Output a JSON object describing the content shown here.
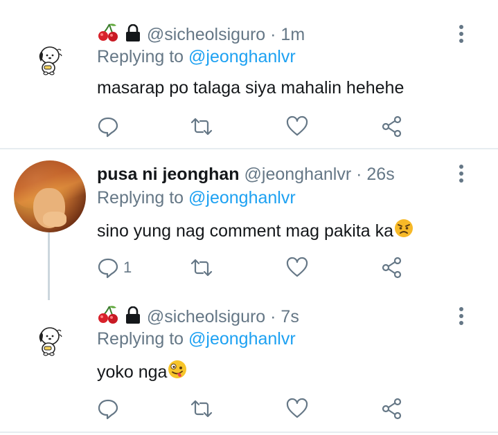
{
  "tweets": [
    {
      "name": "",
      "handle": "@sicheolsiguro",
      "dot": " · ",
      "time": "1m",
      "replying_prefix": "Replying to ",
      "replying_to": "@jeonghanlvr",
      "text": "masarap po talaga siya mahalin hehehe",
      "reply_count": "",
      "avatar_icon": "pochacco-avatar",
      "badges": [
        "cherries-emoji",
        "lock-icon"
      ]
    },
    {
      "name": "pusa ni jeonghan",
      "handle": "@jeonghanlvr",
      "dot": " · ",
      "time": "26s",
      "replying_prefix": "Replying to ",
      "replying_to": "@jeonghanlvr",
      "text": "sino yung nag comment mag pakita ka",
      "text_emoji": "angry-face-emoji",
      "reply_count": "1",
      "avatar_icon": "profile-photo"
    },
    {
      "name": "",
      "handle": "@sicheolsiguro",
      "dot": " · ",
      "time": "7s",
      "replying_prefix": "Replying to ",
      "replying_to": "@jeonghanlvr",
      "text": "yoko nga",
      "text_emoji": "zany-face-emoji",
      "reply_count": "",
      "avatar_icon": "pochacco-avatar",
      "badges": [
        "cherries-emoji",
        "lock-icon"
      ]
    }
  ],
  "colors": {
    "text": "#14171a",
    "secondary": "#657786",
    "link": "#1da1f2",
    "divider": "#e6ecf0"
  }
}
